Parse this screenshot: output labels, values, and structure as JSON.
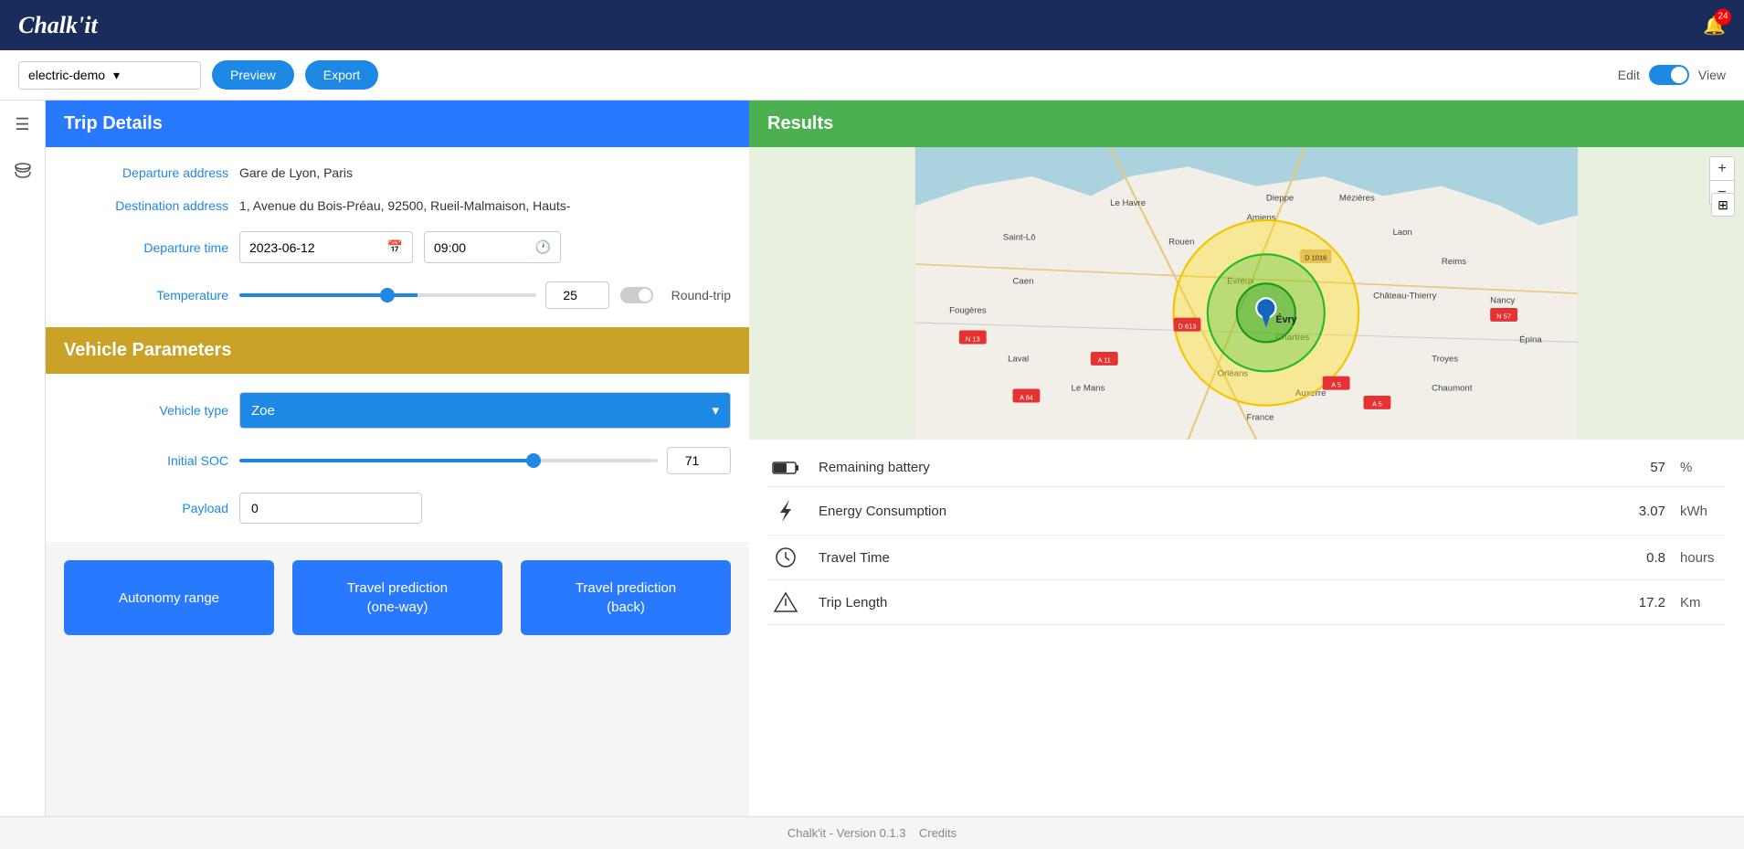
{
  "header": {
    "logo": "Chalk'it",
    "notification_count": "24"
  },
  "toolbar": {
    "selected_demo": "electric-demo",
    "dropdown_arrow": "▾",
    "preview_label": "Preview",
    "export_label": "Export",
    "edit_label": "Edit",
    "view_label": "View"
  },
  "sidebar": {
    "icon1": "☰",
    "icon2": "🗄"
  },
  "trip_details": {
    "section_title": "Trip Details",
    "departure_address_label": "Departure address",
    "departure_address_value": "Gare de Lyon, Paris",
    "destination_address_label": "Destination address",
    "destination_address_value": "1, Avenue du Bois-Préau, 92500, Rueil-Malmaison, Hauts-",
    "departure_time_label": "Departure time",
    "departure_date_value": "2023-06-12",
    "departure_time_value": "09:00",
    "temperature_label": "Temperature",
    "temperature_value": "25",
    "temperature_min": 0,
    "temperature_max": 50,
    "temperature_current": 25,
    "round_trip_label": "Round-trip"
  },
  "vehicle_parameters": {
    "section_title": "Vehicle Parameters",
    "vehicle_type_label": "Vehicle type",
    "vehicle_type_value": "Zoe",
    "initial_soc_label": "Initial SOC",
    "initial_soc_value": "71",
    "initial_soc_current": 71,
    "payload_label": "Payload",
    "payload_value": "0"
  },
  "action_buttons": {
    "autonomy_range_label": "Autonomy range",
    "travel_prediction_one_way_label": "Travel prediction\n(one-way)",
    "travel_prediction_back_label": "Travel prediction\n(back)"
  },
  "results": {
    "section_title": "Results",
    "remaining_battery_label": "Remaining battery",
    "remaining_battery_value": "57",
    "remaining_battery_unit": "%",
    "energy_consumption_label": "Energy Consumption",
    "energy_consumption_value": "3.07",
    "energy_consumption_unit": "kWh",
    "travel_time_label": "Travel Time",
    "travel_time_value": "0.8",
    "travel_time_unit": "hours",
    "trip_length_label": "Trip Length",
    "trip_length_value": "17.2",
    "trip_length_unit": "Km"
  },
  "footer": {
    "version_text": "Chalk'it - Version 0.1.3",
    "credits_label": "Credits"
  },
  "map": {
    "zoom_in": "+",
    "zoom_out": "−",
    "layers_icon": "⊞"
  }
}
